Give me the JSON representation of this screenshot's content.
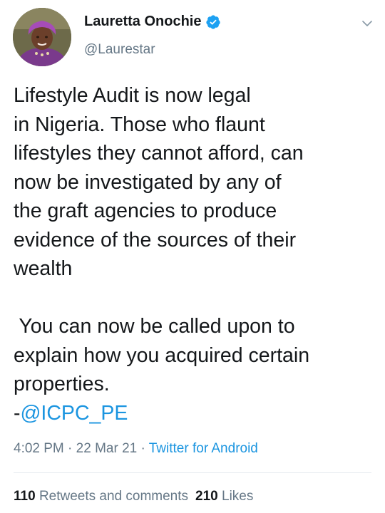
{
  "author": {
    "display_name": "Lauretta Onochie",
    "handle": "@Laurestar",
    "verified": true,
    "avatar_icon": "profile-photo-avatar"
  },
  "tweet": {
    "line1": "Lifestyle Audit is now legal",
    "line2": "in Nigeria. Those who flaunt",
    "line3": "lifestyles they cannot afford, can",
    "line4": "now be investigated by any of",
    "line5": "the graft agencies to produce",
    "line6": "evidence of the sources of their",
    "line7": "wealth",
    "line8": " You can now be called upon to",
    "line9": "explain how you acquired certain",
    "line10": "properties.",
    "attribution_prefix": "-",
    "mention": "@ICPC_PE"
  },
  "meta": {
    "time": "4:02 PM",
    "separator": " · ",
    "date": "22 Mar 21",
    "source": "Twitter for Android"
  },
  "stats": {
    "retweets_count": "110",
    "retweets_label": "Retweets and comments",
    "likes_count": "210",
    "likes_label": "Likes"
  },
  "colors": {
    "link": "#1b95e0",
    "secondary_text": "#657786",
    "primary_text": "#14171a",
    "verified_badge": "#1da1f2"
  }
}
